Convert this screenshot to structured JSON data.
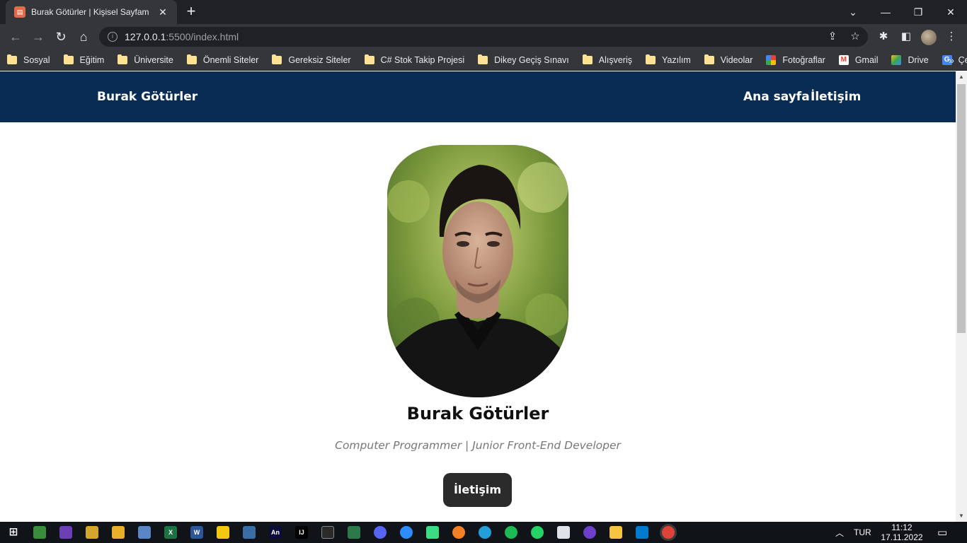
{
  "browser": {
    "tab_title": "Burak Götürler | Kişisel Sayfam",
    "tab_close": "✕",
    "new_tab": "+",
    "url_host": "127.0.0.1",
    "url_path": ":5500/index.html",
    "window_controls": {
      "chevron": "⌄",
      "minimize": "—",
      "restore": "❐",
      "close": "✕"
    },
    "toolbar_icons": [
      "back-icon",
      "forward-icon",
      "reload-icon",
      "home-icon",
      "share-icon",
      "star-icon",
      "extensions-icon",
      "sidepanel-icon",
      "profile-avatar",
      "menu-icon"
    ]
  },
  "bookmarks": [
    {
      "label": "Sosyal",
      "icon": "folder-icon"
    },
    {
      "label": "Eğitim",
      "icon": "folder-icon"
    },
    {
      "label": "Üniversite",
      "icon": "folder-icon"
    },
    {
      "label": "Önemli Siteler",
      "icon": "folder-icon"
    },
    {
      "label": "Gereksiz Siteler",
      "icon": "folder-icon"
    },
    {
      "label": "C# Stok Takip Projesi",
      "icon": "folder-icon"
    },
    {
      "label": "Dikey Geçiş Sınavı",
      "icon": "folder-icon"
    },
    {
      "label": "Alışveriş",
      "icon": "folder-icon"
    },
    {
      "label": "Yazılım",
      "icon": "folder-icon"
    },
    {
      "label": "Videolar",
      "icon": "folder-icon"
    },
    {
      "label": "Fotoğraflar",
      "icon": "photos-icon"
    },
    {
      "label": "Gmail",
      "icon": "gmail-icon"
    },
    {
      "label": "Drive",
      "icon": "drive-icon"
    },
    {
      "label": "Çeviri",
      "icon": "translate-icon"
    }
  ],
  "bookmarks_more": "»",
  "site": {
    "brand": "Burak Götürler",
    "nav": [
      "Ana sayfa",
      "İletişim"
    ],
    "name": "Burak Götürler",
    "subtitle": "Computer Programmer | Junior Front-End Developer",
    "cta": "İletişim"
  },
  "taskbar": {
    "language": "TUR",
    "time": "11:12",
    "date": "17.11.2022"
  },
  "colors": {
    "header_bg": "#082c54",
    "cta_bg": "#2b2b2b",
    "chrome_dark": "#202124",
    "chrome_toolbar": "#35363a"
  }
}
